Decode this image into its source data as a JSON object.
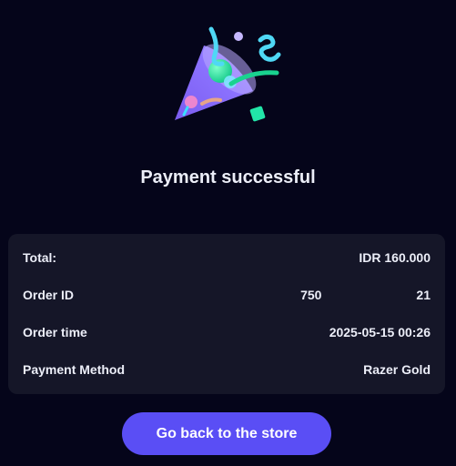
{
  "status": {
    "title": "Payment successful",
    "icon": "party-popper-icon"
  },
  "summary": {
    "rows": [
      {
        "label": "Total:",
        "value": "IDR 160.000"
      },
      {
        "label": "Order ID",
        "value_start": "750",
        "value_end": "21"
      },
      {
        "label": "Order time",
        "value": "2025-05-15 00:26"
      },
      {
        "label": "Payment Method",
        "value": "Razer Gold"
      }
    ]
  },
  "actions": {
    "back_label": "Go back to the store"
  },
  "colors": {
    "background": "#05051a",
    "card": "#151628",
    "accent": "#5a4ef5"
  }
}
